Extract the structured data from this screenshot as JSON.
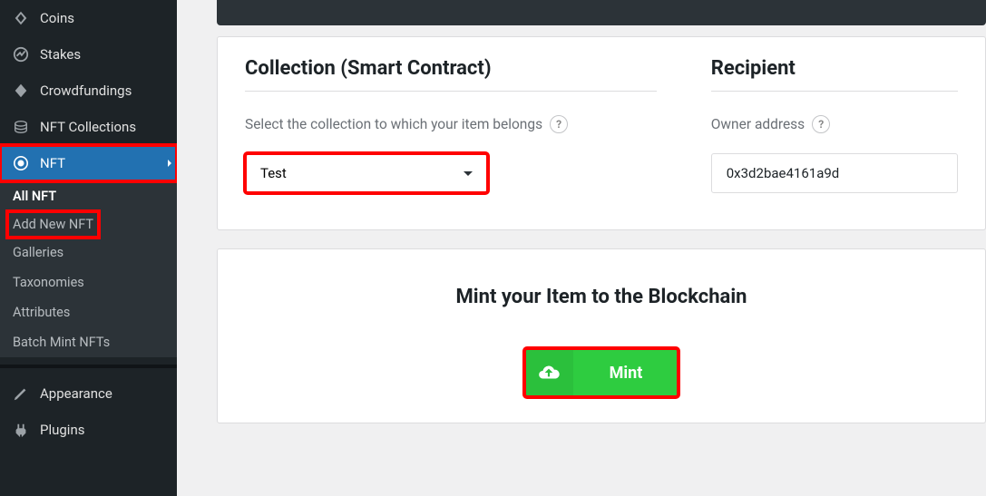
{
  "sidebar": {
    "items": [
      {
        "label": "Coins"
      },
      {
        "label": "Stakes"
      },
      {
        "label": "Crowdfundings"
      },
      {
        "label": "NFT Collections"
      },
      {
        "label": "NFT"
      }
    ],
    "sub": [
      {
        "label": "All NFT"
      },
      {
        "label": "Add New NFT"
      },
      {
        "label": "Galleries"
      },
      {
        "label": "Taxonomies"
      },
      {
        "label": "Attributes"
      },
      {
        "label": "Batch Mint NFTs"
      }
    ],
    "bottom": [
      {
        "label": "Appearance"
      },
      {
        "label": "Plugins"
      }
    ]
  },
  "main": {
    "collection": {
      "title": "Collection (Smart Contract)",
      "label": "Select the collection to which your item belongs",
      "selected": "Test"
    },
    "recipient": {
      "title": "Recipient",
      "label": "Owner address",
      "value": "0x3d2bae4161a9d"
    },
    "mint": {
      "title": "Mint your Item to the Blockchain",
      "button": "Mint"
    }
  }
}
